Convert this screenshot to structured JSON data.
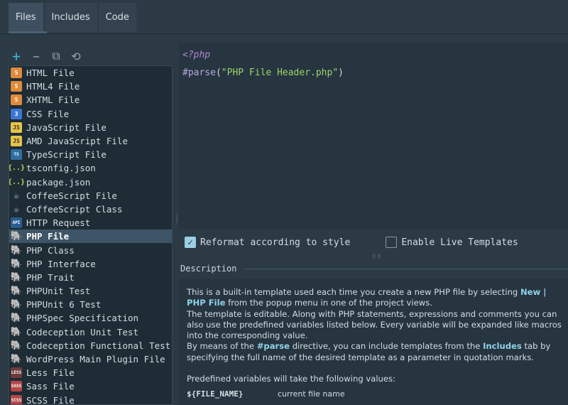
{
  "tabs": [
    {
      "label": "Files"
    },
    {
      "label": "Includes"
    },
    {
      "label": "Code"
    }
  ],
  "toolbar": {
    "add": "+",
    "remove": "−",
    "copy": "⧉",
    "reset": "⟲"
  },
  "templates": [
    {
      "label": "HTML File",
      "icon": "html5-icon"
    },
    {
      "label": "HTML4 File",
      "icon": "html5-icon"
    },
    {
      "label": "XHTML File",
      "icon": "html5-icon"
    },
    {
      "label": "CSS File",
      "icon": "css3-icon"
    },
    {
      "label": "JavaScript File",
      "icon": "javascript-icon"
    },
    {
      "label": "AMD JavaScript File",
      "icon": "javascript-icon"
    },
    {
      "label": "TypeScript File",
      "icon": "typescript-icon"
    },
    {
      "label": "tsconfig.json",
      "icon": "json-icon"
    },
    {
      "label": "package.json",
      "icon": "json-icon"
    },
    {
      "label": "CoffeeScript File",
      "icon": "coffeescript-icon"
    },
    {
      "label": "CoffeeScript Class",
      "icon": "coffeescript-icon"
    },
    {
      "label": "HTTP Request",
      "icon": "api-icon"
    },
    {
      "label": "PHP File",
      "icon": "php-elephant-icon"
    },
    {
      "label": "PHP Class",
      "icon": "php-elephant-icon"
    },
    {
      "label": "PHP Interface",
      "icon": "php-elephant-icon"
    },
    {
      "label": "PHP Trait",
      "icon": "php-elephant-icon"
    },
    {
      "label": "PHPUnit Test",
      "icon": "php-elephant-icon"
    },
    {
      "label": "PHPUnit 6 Test",
      "icon": "php-elephant-icon"
    },
    {
      "label": "PHPSpec Specification",
      "icon": "php-elephant-icon"
    },
    {
      "label": "Codeception Unit Test",
      "icon": "php-elephant-icon"
    },
    {
      "label": "Codeception Functional Test",
      "icon": "php-elephant-icon"
    },
    {
      "label": "WordPress Main Plugin File",
      "icon": "php-elephant-icon"
    },
    {
      "label": "Less File",
      "icon": "less-icon"
    },
    {
      "label": "Sass File",
      "icon": "sass-icon"
    },
    {
      "label": "SCSS File",
      "icon": "scss-icon"
    }
  ],
  "selected_template": "PHP File",
  "editor": {
    "line1": "<?php",
    "line2_directive": "#parse",
    "line2_open": "(",
    "line2_string": "\"PHP File Header.php\"",
    "line2_close": ")"
  },
  "options": {
    "reformat_label": "Reformat according to style",
    "reformat_checked": true,
    "live_templates_label": "Enable Live Templates",
    "live_templates_checked": false
  },
  "description": {
    "heading": "Description",
    "p1_a": "This is a built-in template used each time you create a new PHP file by selecting ",
    "p1_b": "New | PHP File",
    "p1_c": " from the popup menu in one of the project views.",
    "p2": "The template is editable. Along with PHP statements, expressions and comments you can also use the predefined variables listed below. Every variable will be expanded like macros into the corresponding value.",
    "p3_a": "By means of the ",
    "p3_b": "#parse",
    "p3_c": " directive, you can include templates from the ",
    "p3_d": "Includes",
    "p3_e": " tab by specifying the full name of the desired template as a parameter in quotation marks.",
    "p4": "Predefined variables will take the following values:",
    "var_name": "${FILE_NAME}",
    "var_desc": "current file name"
  },
  "colors": {
    "accent": "#3fb3d6",
    "highlight_text": "#8fd3e8",
    "selection": "#3d5566"
  }
}
